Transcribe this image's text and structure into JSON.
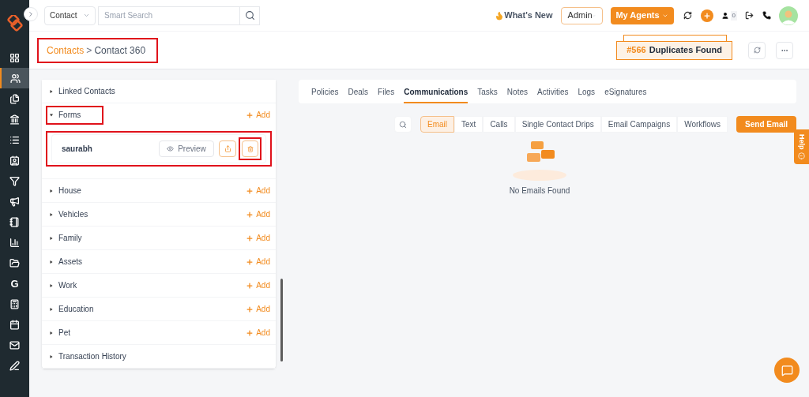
{
  "sidebar": {
    "items": [
      {
        "selected": false
      },
      {
        "selected": true
      },
      {
        "selected": false
      },
      {
        "selected": false
      },
      {
        "selected": false
      },
      {
        "selected": false
      },
      {
        "selected": false
      },
      {
        "selected": false
      },
      {
        "selected": false
      },
      {
        "selected": false
      },
      {
        "selected": false
      },
      {
        "text": "G",
        "selected": false
      },
      {
        "selected": false
      },
      {
        "selected": false
      },
      {
        "selected": false
      },
      {
        "selected": false
      }
    ]
  },
  "topbar": {
    "entity_select": "Contact",
    "search": {
      "placeholder": "Smart Search"
    },
    "whats_new": "What's New",
    "role_select": "Admin",
    "agents_button": "My Agents",
    "notification_count": "0"
  },
  "breadcrumb": {
    "highlighted": true,
    "items": [
      "Contacts",
      "Contact 360"
    ],
    "separator": ">"
  },
  "duplicates": {
    "count": "#566",
    "label": "Duplicates Found"
  },
  "sections": [
    {
      "title": "Linked Contacts",
      "expanded": false,
      "highlighted": false
    },
    {
      "title": "Forms",
      "expanded": true,
      "highlighted": true,
      "add": "Add",
      "forms": [
        {
          "name": "saurabh",
          "preview": "Preview",
          "highlighted": true,
          "delete_highlighted": true
        }
      ]
    },
    {
      "title": "House",
      "expanded": false,
      "highlighted": false,
      "add": "Add"
    },
    {
      "title": "Vehicles",
      "expanded": false,
      "highlighted": false,
      "add": "Add"
    },
    {
      "title": "Family",
      "expanded": false,
      "highlighted": false,
      "add": "Add"
    },
    {
      "title": "Assets",
      "expanded": false,
      "highlighted": false,
      "add": "Add"
    },
    {
      "title": "Work",
      "expanded": false,
      "highlighted": false,
      "add": "Add"
    },
    {
      "title": "Education",
      "expanded": false,
      "highlighted": false,
      "add": "Add"
    },
    {
      "title": "Pet",
      "expanded": false,
      "highlighted": false,
      "add": "Add"
    },
    {
      "title": "Transaction History",
      "expanded": false,
      "highlighted": false
    }
  ],
  "tabs": [
    {
      "label": "Policies",
      "selected": false
    },
    {
      "label": "Deals",
      "selected": false
    },
    {
      "label": "Files",
      "selected": false
    },
    {
      "label": "Communications",
      "selected": true
    },
    {
      "label": "Tasks",
      "selected": false
    },
    {
      "label": "Notes",
      "selected": false
    },
    {
      "label": "Activities",
      "selected": false
    },
    {
      "label": "Logs",
      "selected": false
    },
    {
      "label": "eSignatures",
      "selected": false
    }
  ],
  "comm_tabs": [
    {
      "label": "Email",
      "selected": true
    },
    {
      "label": "Text",
      "selected": false
    },
    {
      "label": "Calls",
      "selected": false
    },
    {
      "label": "Single Contact Drips",
      "selected": false
    },
    {
      "label": "Email Campaigns",
      "selected": false
    },
    {
      "label": "Workflows",
      "selected": false
    }
  ],
  "send_button": "Send Email",
  "empty_message": "No Emails Found",
  "help_tab": "Help"
}
